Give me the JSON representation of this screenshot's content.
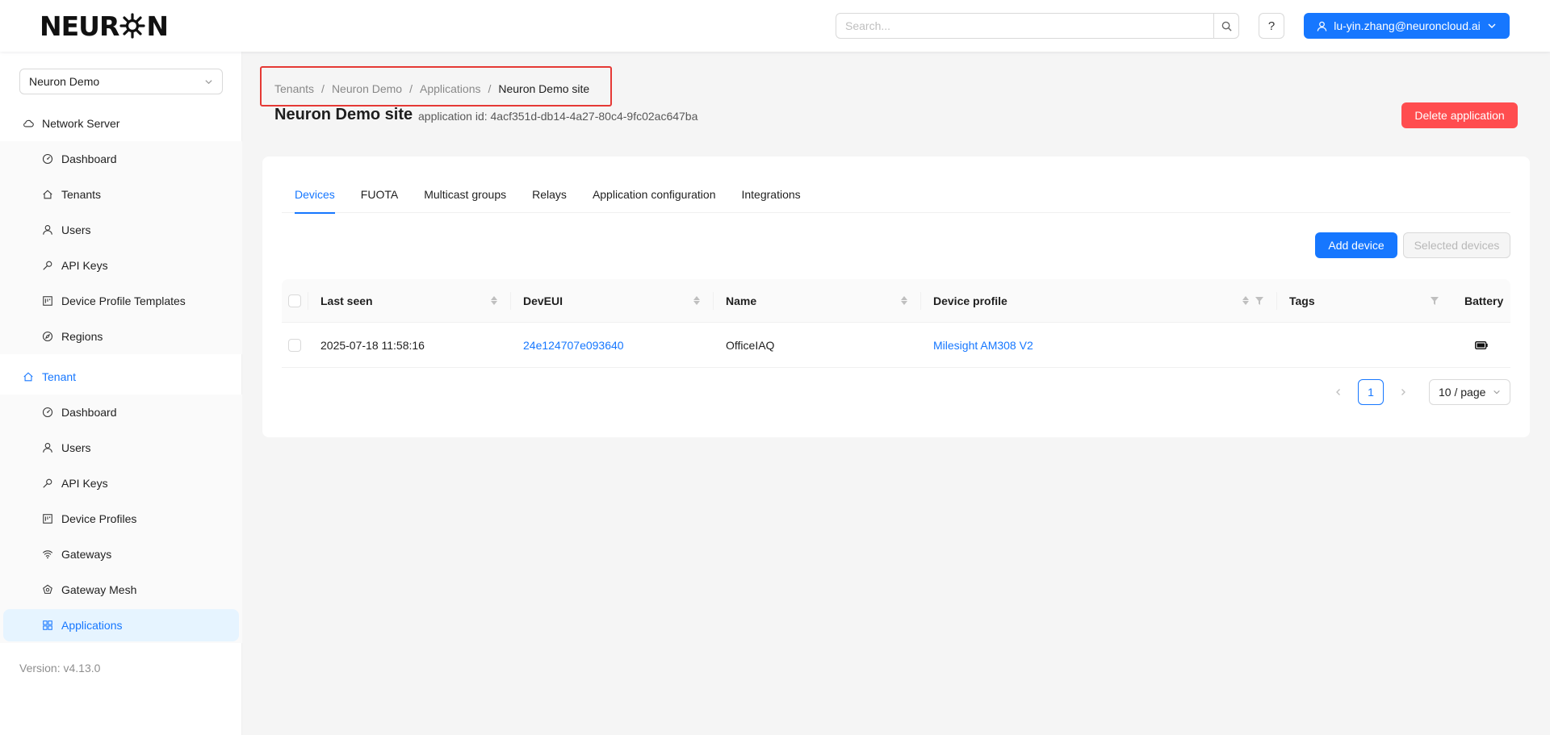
{
  "header": {
    "logo_left": "NEUR",
    "logo_right": "N",
    "search_placeholder": "Search...",
    "help_label": "?",
    "user_email": "lu-yin.zhang@neuroncloud.ai"
  },
  "sidebar": {
    "tenant_selected": "Neuron Demo",
    "network_server_label": "Network Server",
    "network_server_items": [
      {
        "label": "Dashboard",
        "icon": "dashboard-icon"
      },
      {
        "label": "Tenants",
        "icon": "home-icon"
      },
      {
        "label": "Users",
        "icon": "user-icon"
      },
      {
        "label": "API Keys",
        "icon": "key-icon"
      },
      {
        "label": "Device Profile Templates",
        "icon": "profile-icon"
      },
      {
        "label": "Regions",
        "icon": "compass-icon"
      }
    ],
    "tenant_label": "Tenant",
    "tenant_items": [
      {
        "label": "Dashboard",
        "icon": "dashboard-icon"
      },
      {
        "label": "Users",
        "icon": "user-icon"
      },
      {
        "label": "API Keys",
        "icon": "key-icon"
      },
      {
        "label": "Device Profiles",
        "icon": "profile-icon"
      },
      {
        "label": "Gateways",
        "icon": "wifi-icon"
      },
      {
        "label": "Gateway Mesh",
        "icon": "mesh-icon"
      },
      {
        "label": "Applications",
        "icon": "apps-icon"
      }
    ],
    "version": "Version: v4.13.0"
  },
  "breadcrumb": [
    "Tenants",
    "Neuron Demo",
    "Applications",
    "Neuron Demo site"
  ],
  "page": {
    "title": "Neuron Demo site",
    "subtitle": "application id: 4acf351d-db14-4a27-80c4-9fc02ac647ba",
    "delete_label": "Delete application"
  },
  "tabs": [
    "Devices",
    "FUOTA",
    "Multicast groups",
    "Relays",
    "Application configuration",
    "Integrations"
  ],
  "actions": {
    "add_device": "Add device",
    "selected_devices": "Selected devices"
  },
  "table": {
    "columns": [
      "Last seen",
      "DevEUI",
      "Name",
      "Device profile",
      "Tags",
      "Battery"
    ],
    "rows": [
      {
        "last_seen": "2025-07-18 11:58:16",
        "dev_eui": "24e124707e093640",
        "name": "OfficeIAQ",
        "device_profile": "Milesight AM308 V2",
        "tags": "",
        "battery": "battery-icon"
      }
    ]
  },
  "pagination": {
    "current_page": "1",
    "page_size": "10 / page"
  },
  "colors": {
    "primary": "#1677ff",
    "danger": "#ff4d4f",
    "highlight": "#e53935"
  }
}
